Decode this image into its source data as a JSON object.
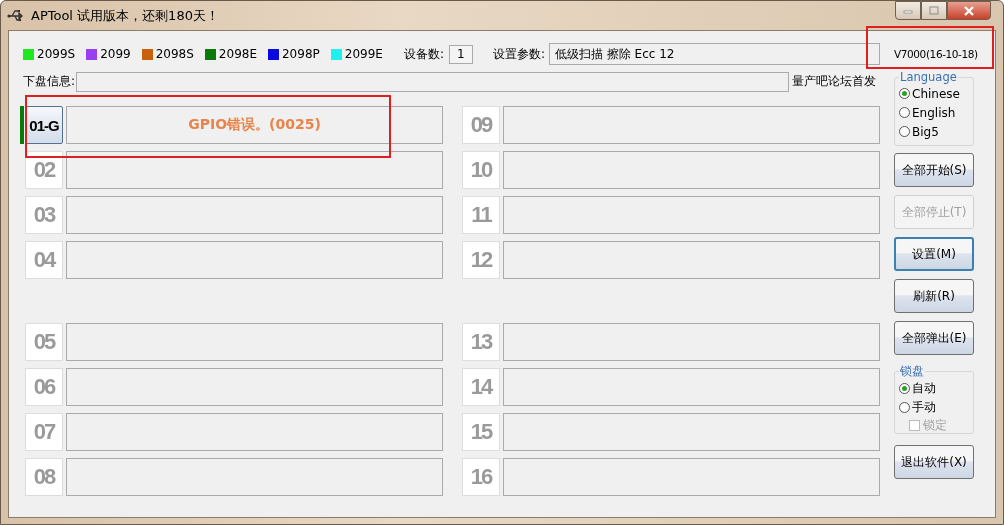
{
  "window": {
    "title": "APTool  试用版本，还剩180天！"
  },
  "legend": [
    {
      "label": "2099S",
      "color": "#1fe81f"
    },
    {
      "label": "2099",
      "color": "#9a3ff0"
    },
    {
      "label": "2098S",
      "color": "#c8600c"
    },
    {
      "label": "2098E",
      "color": "#0a7a0a"
    },
    {
      "label": "2098P",
      "color": "#0a0ae0"
    },
    {
      "label": "2099E",
      "color": "#1ef0f0"
    }
  ],
  "device_count": {
    "label": "设备数:",
    "value": "1"
  },
  "settings_param": {
    "label": "设置参数:",
    "value": "低级扫描 擦除 Ecc 12"
  },
  "version": "V7000(16-10-18)",
  "disk_info": {
    "label": "下盘信息:"
  },
  "forum_note": "量产吧论坛首发",
  "slots": [
    {
      "label": "01-G",
      "active": true,
      "status": "GPIO错误。(0025)"
    },
    {
      "label": "02",
      "active": false
    },
    {
      "label": "03",
      "active": false
    },
    {
      "label": "04",
      "active": false
    },
    {
      "label": "05",
      "active": false
    },
    {
      "label": "06",
      "active": false
    },
    {
      "label": "07",
      "active": false
    },
    {
      "label": "08",
      "active": false
    },
    {
      "label": "09",
      "active": false
    },
    {
      "label": "10",
      "active": false
    },
    {
      "label": "11",
      "active": false
    },
    {
      "label": "12",
      "active": false
    },
    {
      "label": "13",
      "active": false
    },
    {
      "label": "14",
      "active": false
    },
    {
      "label": "15",
      "active": false
    },
    {
      "label": "16",
      "active": false
    }
  ],
  "language": {
    "title": "Language",
    "options": [
      {
        "label": "Chinese",
        "selected": true
      },
      {
        "label": "English",
        "selected": false
      },
      {
        "label": "Big5",
        "selected": false
      }
    ]
  },
  "buttons": [
    {
      "label": "全部开始(S)",
      "disabled": false,
      "focused": false
    },
    {
      "label": "全部停止(T)",
      "disabled": true,
      "focused": false
    },
    {
      "label": "设置(M)",
      "disabled": false,
      "focused": true
    },
    {
      "label": "刷新(R)",
      "disabled": false,
      "focused": false
    },
    {
      "label": "全部弹出(E)",
      "disabled": false,
      "focused": false
    }
  ],
  "lock": {
    "title": "锁盘",
    "options": [
      {
        "label": "自动",
        "selected": true
      },
      {
        "label": "手动",
        "selected": false
      }
    ],
    "checkbox": {
      "label": "锁定",
      "checked": false,
      "disabled": true
    }
  },
  "exit_button": {
    "label": "退出软件(X)"
  }
}
